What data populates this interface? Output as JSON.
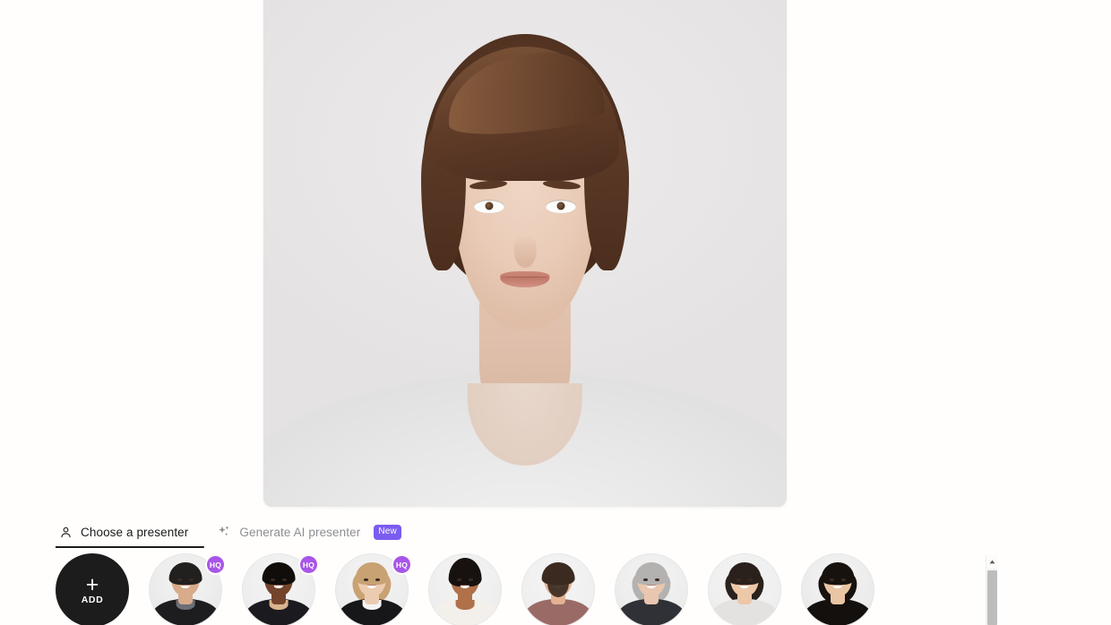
{
  "preview": {
    "alt": "Selected presenter preview — young woman with short wavy brown hair, light gray t-shirt, neutral gray background"
  },
  "tabs": [
    {
      "id": "choose-a-presenter",
      "label": "Choose a presenter",
      "icon": "user-icon",
      "active": true,
      "badge": null
    },
    {
      "id": "generate-ai-presenter",
      "label": "Generate AI presenter",
      "icon": "sparkles-icon",
      "active": false,
      "badge": "New"
    }
  ],
  "add_button": {
    "glyph": "+",
    "label": "ADD"
  },
  "presenters": [
    {
      "id": "presenter-1",
      "name": "Man in black blazer",
      "hq": true,
      "hq_label": "HQ",
      "skin": "#d8ab8a",
      "hair": "#22201f",
      "clothes": "#1d1d20",
      "collar": "#6c6f75",
      "bg": "#e9e9e9",
      "hair_style": "short"
    },
    {
      "id": "presenter-2",
      "name": "Man in dark suit",
      "hq": true,
      "hq_label": "HQ",
      "skin": "#74452c",
      "hair": "#100d0b",
      "clothes": "#1b1b1f",
      "collar": "#d9b48e",
      "bg": "#ededed",
      "hair_style": "short"
    },
    {
      "id": "presenter-3",
      "name": "Woman in black jacket with white collar",
      "hq": true,
      "hq_label": "HQ",
      "skin": "#edcbb0",
      "hair": "#c9a273",
      "clothes": "#17171a",
      "collar": "#f4f4f4",
      "bg": "#ececec",
      "hair_style": "long"
    },
    {
      "id": "presenter-4",
      "name": "Woman with updo hairstyle",
      "hq": false,
      "hq_label": null,
      "skin": "#b0714a",
      "hair": "#17120f",
      "clothes": "#f3efeb",
      "collar": "#b0714a",
      "bg": "#ededed",
      "hair_style": "updo"
    },
    {
      "id": "presenter-5",
      "name": "Bearded man in maroon shirt",
      "hq": false,
      "hq_label": null,
      "skin": "#e4b293",
      "hair": "#3b2a20",
      "clothes": "#9a6b66",
      "collar": "#9a6b66",
      "bg": "#efefef",
      "hair_style": "beard"
    },
    {
      "id": "presenter-6",
      "name": "Woman with gray hair",
      "hq": false,
      "hq_label": null,
      "skin": "#e8c6b0",
      "hair": "#b4b2b0",
      "clothes": "#2f3136",
      "collar": "#2f3136",
      "bg": "#ebebeb",
      "hair_style": "long"
    },
    {
      "id": "presenter-7",
      "name": "Smiling woman with bob haircut",
      "hq": false,
      "hq_label": null,
      "skin": "#ecc7a8",
      "hair": "#2a211c",
      "clothes": "#e4e2e0",
      "collar": "#e4e2e0",
      "bg": "#eeeeee",
      "hair_style": "bob"
    },
    {
      "id": "presenter-8",
      "name": "Woman with long dark hair",
      "hq": false,
      "hq_label": null,
      "skin": "#eac5a3",
      "hair": "#18120e",
      "clothes": "#14100d",
      "collar": "#14100d",
      "bg": "#eaeaea",
      "hair_style": "long"
    }
  ],
  "scrollbar": {
    "up_arrow": "chevron-up-icon",
    "orientation": "vertical"
  },
  "colors": {
    "accent_purple": "#7b5cf0",
    "hq_purple": "#a855e8",
    "dark": "#1c1c1c",
    "muted_text": "#8e8e93",
    "page_bg": "#fffefc"
  }
}
